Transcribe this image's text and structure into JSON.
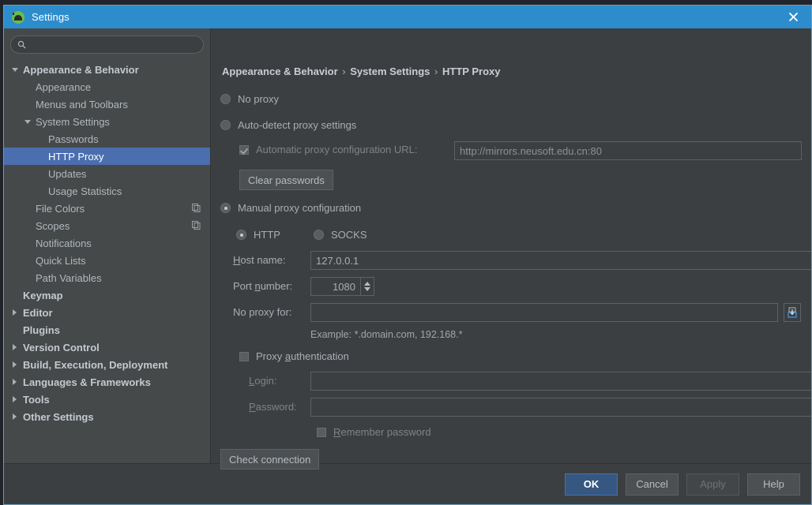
{
  "window": {
    "title": "Settings",
    "app_icon": "android-studio-icon",
    "close_icon": "close-icon"
  },
  "sidebar": {
    "search": {
      "value": "",
      "placeholder": "",
      "icon": "search-icon"
    },
    "items": [
      {
        "label": "Appearance & Behavior",
        "indent": 0,
        "arrow": "down",
        "bold": true,
        "selected": false,
        "badge": null
      },
      {
        "label": "Appearance",
        "indent": 1,
        "arrow": "none",
        "bold": false,
        "selected": false,
        "badge": null
      },
      {
        "label": "Menus and Toolbars",
        "indent": 1,
        "arrow": "none",
        "bold": false,
        "selected": false,
        "badge": null
      },
      {
        "label": "System Settings",
        "indent": 1,
        "arrow": "down",
        "bold": false,
        "selected": false,
        "badge": null
      },
      {
        "label": "Passwords",
        "indent": 2,
        "arrow": "none",
        "bold": false,
        "selected": false,
        "badge": null
      },
      {
        "label": "HTTP Proxy",
        "indent": 2,
        "arrow": "none",
        "bold": false,
        "selected": true,
        "badge": null
      },
      {
        "label": "Updates",
        "indent": 2,
        "arrow": "none",
        "bold": false,
        "selected": false,
        "badge": null
      },
      {
        "label": "Usage Statistics",
        "indent": 2,
        "arrow": "none",
        "bold": false,
        "selected": false,
        "badge": null
      },
      {
        "label": "File Colors",
        "indent": 1,
        "arrow": "none",
        "bold": false,
        "selected": false,
        "badge": "copy-icon"
      },
      {
        "label": "Scopes",
        "indent": 1,
        "arrow": "none",
        "bold": false,
        "selected": false,
        "badge": "copy-icon"
      },
      {
        "label": "Notifications",
        "indent": 1,
        "arrow": "none",
        "bold": false,
        "selected": false,
        "badge": null
      },
      {
        "label": "Quick Lists",
        "indent": 1,
        "arrow": "none",
        "bold": false,
        "selected": false,
        "badge": null
      },
      {
        "label": "Path Variables",
        "indent": 1,
        "arrow": "none",
        "bold": false,
        "selected": false,
        "badge": null
      },
      {
        "label": "Keymap",
        "indent": 0,
        "arrow": "none",
        "bold": true,
        "selected": false,
        "badge": null
      },
      {
        "label": "Editor",
        "indent": 0,
        "arrow": "right",
        "bold": true,
        "selected": false,
        "badge": null
      },
      {
        "label": "Plugins",
        "indent": 0,
        "arrow": "none",
        "bold": true,
        "selected": false,
        "badge": null
      },
      {
        "label": "Version Control",
        "indent": 0,
        "arrow": "right",
        "bold": true,
        "selected": false,
        "badge": null
      },
      {
        "label": "Build, Execution, Deployment",
        "indent": 0,
        "arrow": "right",
        "bold": true,
        "selected": false,
        "badge": null
      },
      {
        "label": "Languages & Frameworks",
        "indent": 0,
        "arrow": "right",
        "bold": true,
        "selected": false,
        "badge": null
      },
      {
        "label": "Tools",
        "indent": 0,
        "arrow": "right",
        "bold": true,
        "selected": false,
        "badge": null
      },
      {
        "label": "Other Settings",
        "indent": 0,
        "arrow": "right",
        "bold": true,
        "selected": false,
        "badge": null
      }
    ]
  },
  "breadcrumb": {
    "part1": "Appearance & Behavior",
    "sep1": "›",
    "part2": "System Settings",
    "sep2": "›",
    "part3": "HTTP Proxy"
  },
  "form": {
    "no_proxy_label": "No proxy",
    "no_proxy_selected": false,
    "auto_detect_label": "Auto-detect proxy settings",
    "auto_detect_selected": false,
    "auto_url_checkbox_label": "Automatic proxy configuration URL:",
    "auto_url_checked": true,
    "auto_url_value": "http://mirrors.neusoft.edu.cn:80",
    "clear_passwords_label": "Clear passwords",
    "manual_label": "Manual proxy configuration",
    "manual_selected": true,
    "http_label": "HTTP",
    "http_selected": true,
    "socks_label": "SOCKS",
    "socks_selected": false,
    "host_label_pre": "H",
    "host_label_post": "ost name:",
    "host_value": "127.0.0.1",
    "port_label_pre": "Port ",
    "port_label_mn": "n",
    "port_label_post": "umber:",
    "port_value": "1080",
    "no_proxy_for_label": "No proxy for:",
    "no_proxy_for_value": "",
    "import_icon": "import-list-icon",
    "example_text": "Example: *.domain.com, 192.168.*",
    "proxy_auth_label_pre": "Proxy ",
    "proxy_auth_label_mn": "a",
    "proxy_auth_label_post": "uthentication",
    "proxy_auth_checked": false,
    "login_label_pre": "L",
    "login_label_post": "ogin:",
    "login_value": "",
    "password_label_pre": "P",
    "password_label_post": "assword:",
    "password_value": "",
    "remember_label_pre": "R",
    "remember_label_post": "emember password",
    "remember_checked": false,
    "check_connection_label": "Check connection"
  },
  "footer": {
    "ok": "OK",
    "cancel": "Cancel",
    "apply": "Apply",
    "help": "Help"
  },
  "colors": {
    "titlebar": "#2d8dcc",
    "selection": "#4b6eaf",
    "sidebar_bg": "#45494a",
    "panel_bg": "#3c3f41",
    "default_button": "#365880",
    "border": "#6b9dba"
  }
}
